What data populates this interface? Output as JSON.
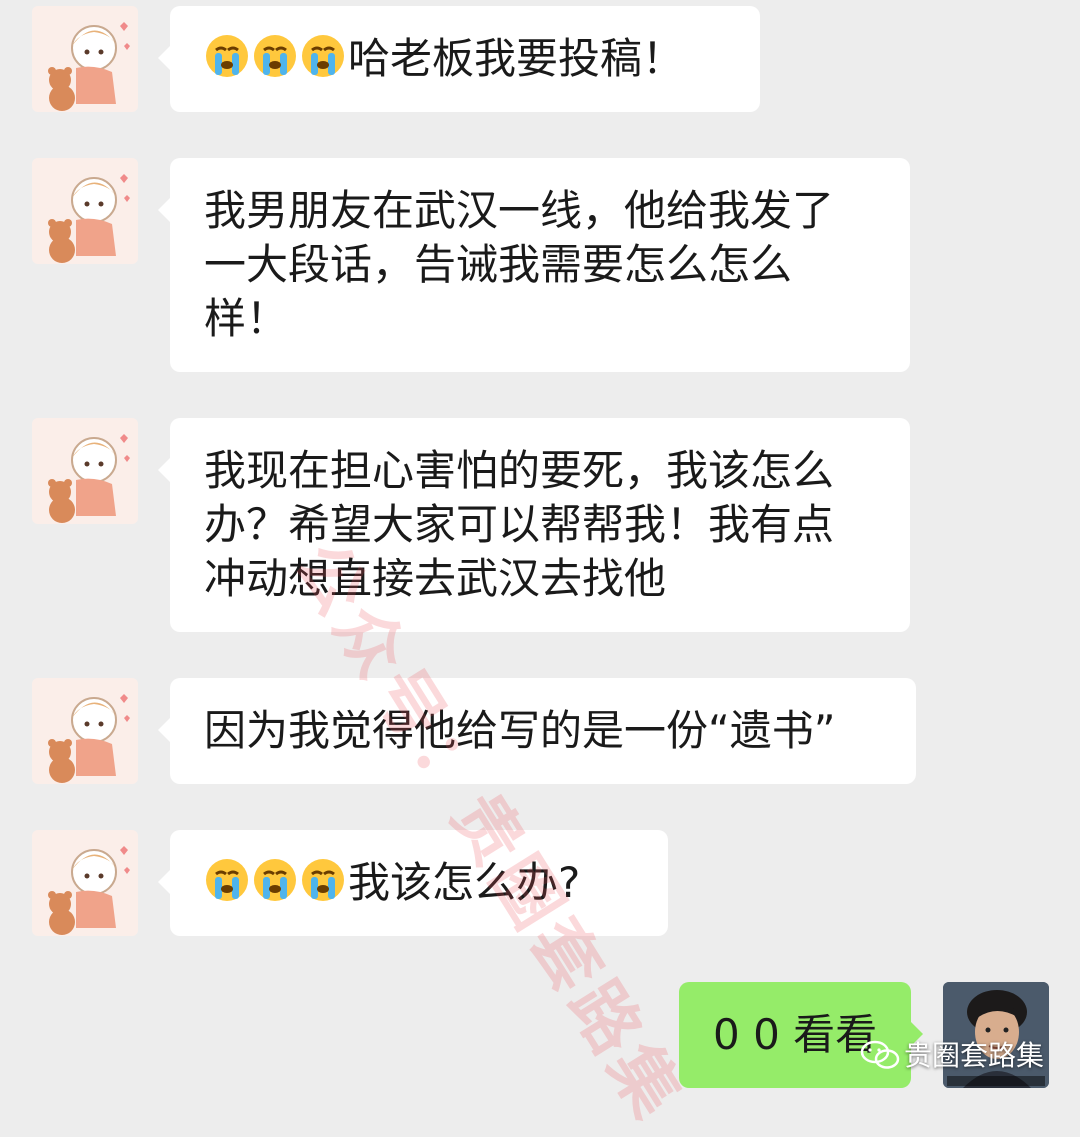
{
  "chat": {
    "messages": [
      {
        "sender": "other",
        "lines": [
          "哈老板我要投稿！"
        ],
        "leading_emoji": {
          "icon": "crying-emoji",
          "count": 3
        }
      },
      {
        "sender": "other",
        "lines": [
          "我男朋友在武汉一线，他给我发了",
          "一大段话，告诫我需要怎么怎么",
          "样！"
        ]
      },
      {
        "sender": "other",
        "lines": [
          "我现在担心害怕的要死，我该怎么",
          "办？希望大家可以帮帮我！我有点",
          "冲动想直接去武汉去找他"
        ]
      },
      {
        "sender": "other",
        "lines": [
          "因为我觉得他给写的是一份“遗书”"
        ]
      },
      {
        "sender": "other",
        "lines": [
          "我该怎么办?"
        ],
        "leading_emoji": {
          "icon": "crying-emoji",
          "count": 3
        }
      },
      {
        "sender": "self",
        "lines": [
          "0 0 看看"
        ]
      }
    ]
  },
  "watermark": {
    "text": "公众号：贵圈套路集"
  },
  "brand": {
    "text": "贵圈套路集",
    "icon": "wechat-icon"
  },
  "colors": {
    "background": "#ededed",
    "bubble_other": "#ffffff",
    "bubble_self": "#95ec69",
    "watermark": "#eb505a"
  }
}
